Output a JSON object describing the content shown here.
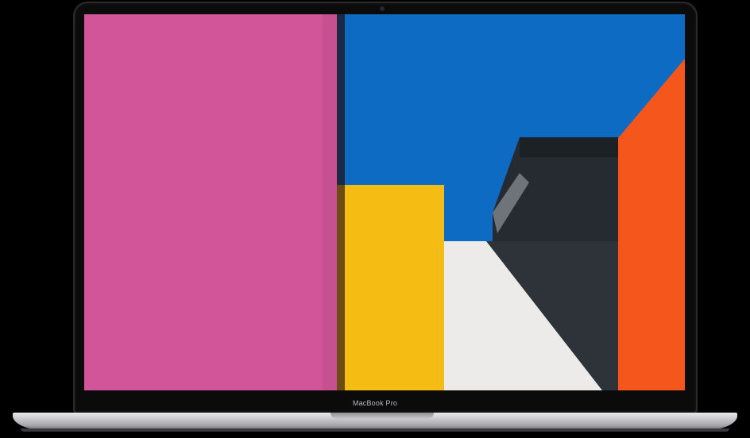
{
  "device": {
    "model_label": "MacBook Pro"
  },
  "screen_image": {
    "description_colors": {
      "pink_wall": "#d2559a",
      "sky": "#0e6bc4",
      "yellow_block": "#f5bd14",
      "white_wall": "#eeeeec",
      "dark_building": "#2b3136",
      "orange_wall": "#f4561c"
    }
  }
}
